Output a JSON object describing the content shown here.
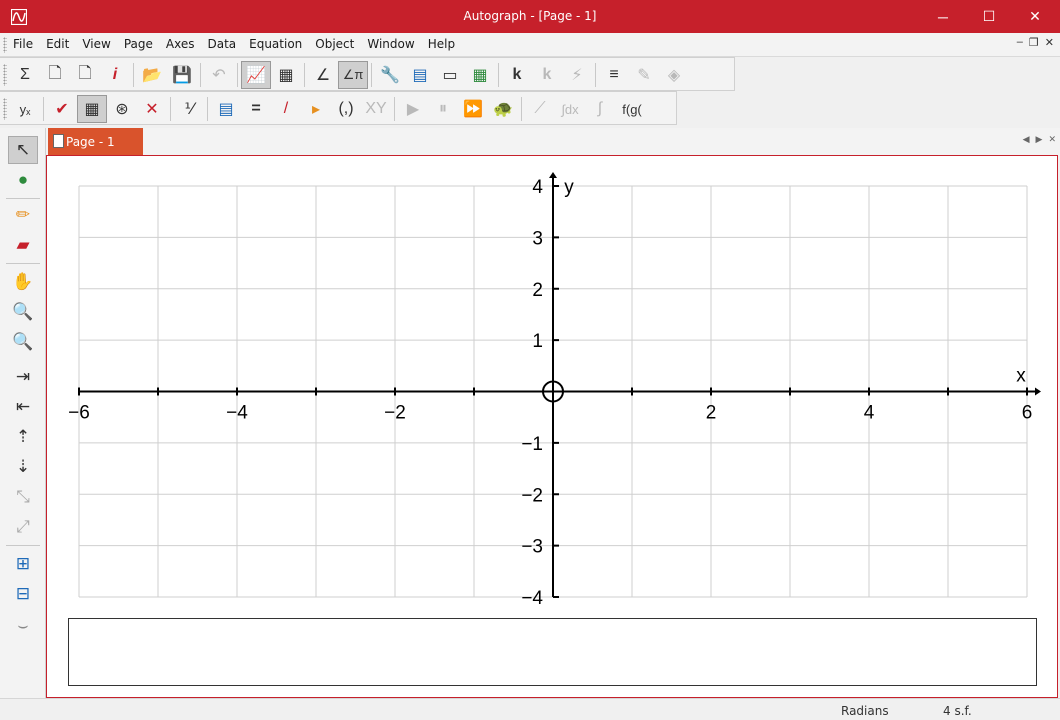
{
  "window": {
    "title": "Autograph - [Page - 1]",
    "accent": "#c6202b",
    "controls": {
      "minimize": "─",
      "maximize": "☐",
      "close": "✕"
    }
  },
  "menubar": {
    "items": [
      "File",
      "Edit",
      "View",
      "Page",
      "Axes",
      "Data",
      "Equation",
      "Object",
      "Window",
      "Help"
    ],
    "mdi": {
      "minimize": "–",
      "restore": "❐",
      "close": "✕"
    }
  },
  "toolbar1": {
    "buttons": [
      {
        "name": "sigma-icon",
        "glyph": "Σ"
      },
      {
        "name": "new-page-icon",
        "glyph": "🗋"
      },
      {
        "name": "page-icon",
        "glyph": "🗋"
      },
      {
        "name": "info-page-icon",
        "glyph": "i"
      },
      {
        "name": "open-folder-icon",
        "glyph": "📂"
      },
      {
        "name": "save-icon",
        "glyph": "💾"
      },
      {
        "name": "undo-icon",
        "glyph": "↶"
      },
      {
        "name": "graph-2d-icon",
        "glyph": "📈"
      },
      {
        "name": "graph-stats-icon",
        "glyph": "▦"
      },
      {
        "name": "angle-degrees-icon",
        "glyph": "∠"
      },
      {
        "name": "angle-radians-icon",
        "glyph": "∠π"
      },
      {
        "name": "settings-icon",
        "glyph": "🔧"
      },
      {
        "name": "table-icon",
        "glyph": "▤"
      },
      {
        "name": "text-box-icon",
        "glyph": "▭"
      },
      {
        "name": "calculator-icon",
        "glyph": "▦"
      },
      {
        "name": "constant-controller-icon",
        "glyph": "k"
      },
      {
        "name": "constant-animate-icon",
        "glyph": "k"
      },
      {
        "name": "flash-icon",
        "glyph": "⚡"
      },
      {
        "name": "line-style-icon",
        "glyph": "≡"
      },
      {
        "name": "line-color-icon",
        "glyph": "✎"
      },
      {
        "name": "fill-color-icon",
        "glyph": "◈"
      }
    ]
  },
  "toolbar2": {
    "buttons": [
      {
        "name": "axis-select-icon",
        "glyph": "yₓ"
      },
      {
        "name": "checkmark-icon",
        "glyph": "✔"
      },
      {
        "name": "grid-icon",
        "glyph": "▦"
      },
      {
        "name": "polar-grid-icon",
        "glyph": "⊛"
      },
      {
        "name": "delete-point-icon",
        "glyph": "✕"
      },
      {
        "name": "scale-icon",
        "glyph": "⅟"
      },
      {
        "name": "add-table-icon",
        "glyph": "▤"
      },
      {
        "name": "add-equation-icon",
        "glyph": "="
      },
      {
        "name": "add-line-icon",
        "glyph": "/"
      },
      {
        "name": "add-point-icon",
        "glyph": "▸"
      },
      {
        "name": "coordinate-icon",
        "glyph": "(,)"
      },
      {
        "name": "xy-icon",
        "glyph": "XY"
      },
      {
        "name": "play-icon",
        "glyph": "▶"
      },
      {
        "name": "pause-icon",
        "glyph": "⏸"
      },
      {
        "name": "fast-forward-icon",
        "glyph": "⏩"
      },
      {
        "name": "turtle-icon",
        "glyph": "🐢"
      },
      {
        "name": "tangent-icon",
        "glyph": "⟋"
      },
      {
        "name": "integral-icon",
        "glyph": "∫dx"
      },
      {
        "name": "derivative-icon",
        "glyph": "∫"
      },
      {
        "name": "function-composition-icon",
        "glyph": "f(g("
      }
    ]
  },
  "left_toolbar": {
    "buttons": [
      {
        "name": "select-arrow-icon",
        "glyph": "↖"
      },
      {
        "name": "add-point-icon",
        "glyph": "●"
      },
      {
        "name": "pencil-icon",
        "glyph": "✏"
      },
      {
        "name": "eraser-icon",
        "glyph": "▰"
      },
      {
        "name": "hand-pan-icon",
        "glyph": "✋"
      },
      {
        "name": "zoom-in-icon",
        "glyph": "🔍"
      },
      {
        "name": "zoom-out-icon",
        "glyph": "🔍"
      },
      {
        "name": "x-stretch-in-icon",
        "glyph": "⇥"
      },
      {
        "name": "x-stretch-out-icon",
        "glyph": "⇤"
      },
      {
        "name": "y-stretch-in-icon",
        "glyph": "⇡"
      },
      {
        "name": "y-stretch-out-icon",
        "glyph": "⇣"
      },
      {
        "name": "zoom-diagonal-in-icon",
        "glyph": "⤡"
      },
      {
        "name": "zoom-diagonal-out-icon",
        "glyph": "⤢"
      },
      {
        "name": "zoom-box-in-icon",
        "glyph": "⊞"
      },
      {
        "name": "zoom-box-out-icon",
        "glyph": "⊟"
      },
      {
        "name": "curve-add-icon",
        "glyph": "⌣"
      }
    ]
  },
  "tabs": [
    {
      "label": "Page - 1"
    }
  ],
  "graph": {
    "x_label": "x",
    "y_label": "y",
    "x_range": [
      -6,
      6
    ],
    "y_range": [
      -4,
      4
    ],
    "x_tick_labels": [
      "−6",
      "−4",
      "−2",
      "2",
      "4",
      "6"
    ],
    "y_tick_labels": [
      "4",
      "3",
      "2",
      "1",
      "−1",
      "−2",
      "−3",
      "−4"
    ],
    "grid": true
  },
  "statusbar": {
    "angle_mode": "Radians",
    "precision": "4 s.f."
  }
}
